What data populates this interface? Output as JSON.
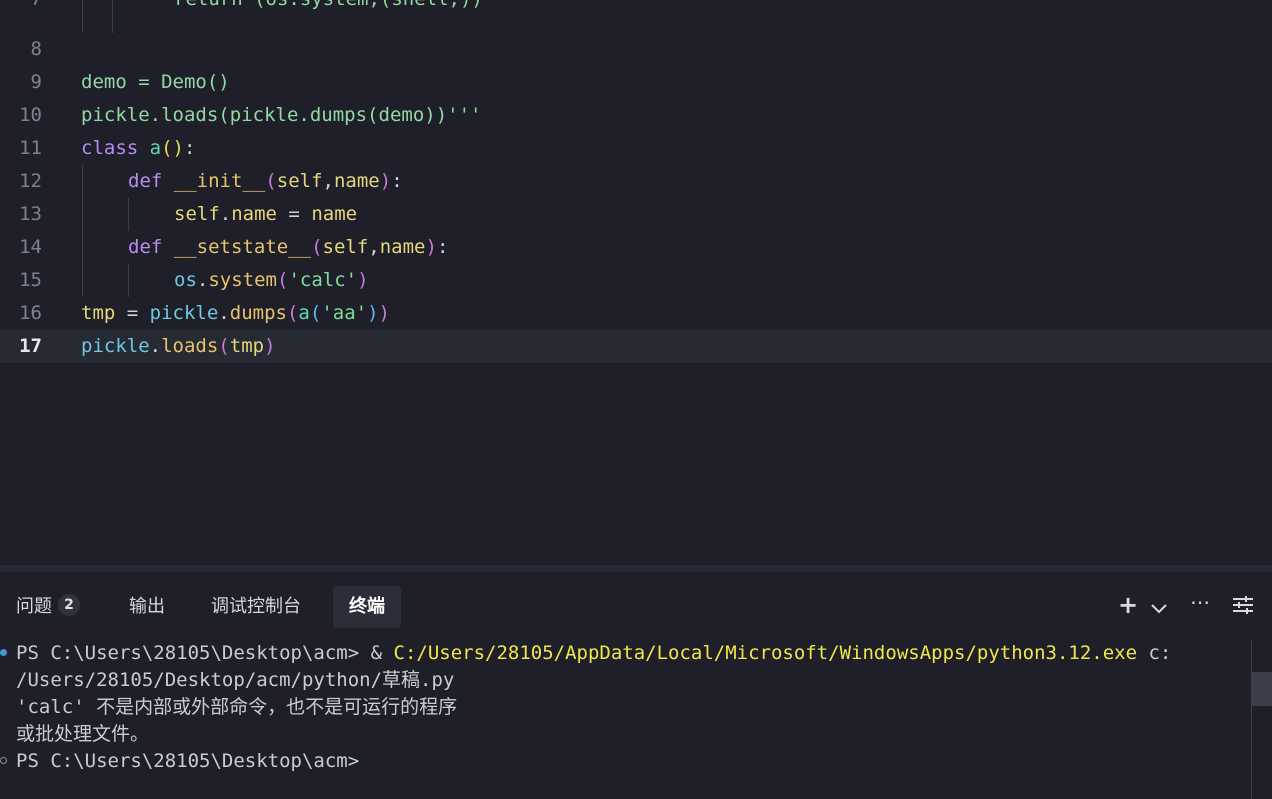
{
  "editor": {
    "lines": [
      {
        "num": "7",
        "partial": "return (os.system,(shell,))"
      },
      {
        "num": "8"
      },
      {
        "num": "9"
      },
      {
        "num": "10"
      },
      {
        "num": "11"
      },
      {
        "num": "12"
      },
      {
        "num": "13"
      },
      {
        "num": "14"
      },
      {
        "num": "15"
      },
      {
        "num": "16"
      },
      {
        "num": "17"
      }
    ],
    "tokens": {
      "demo": "demo",
      "eq": " = ",
      "Demo": "Demo",
      "call": "()",
      "pickle": "pickle",
      "dot": ".",
      "loads": "loads",
      "lp": "(",
      "dumps": "dumps",
      "demo_arg": "demo",
      "rpp": "))",
      "tq": "'''",
      "class": "class",
      "a": "a",
      "paren_call": "()",
      "colon": ":",
      "def": "def",
      "init": "__init__",
      "self": "self",
      "comma": ",",
      "name": "name",
      "rp": ")",
      "self2": "self",
      "name_attr": "name",
      "name_val": "name",
      "setstate": "__setstate__",
      "os": "os",
      "system": "system",
      "calc_str": "'calc'",
      "tmp": "tmp",
      "aa_str": "'aa'",
      "tmp_arg": "tmp"
    }
  },
  "panel": {
    "tabs": {
      "problems": "问题",
      "problems_count": "2",
      "output": "输出",
      "debug_console": "调试控制台",
      "terminal": "终端"
    },
    "icons": {
      "add": "plus-icon",
      "dropdown": "chevron-down-icon",
      "more": "more-icon",
      "layout": "sliders-icon"
    },
    "terminal": {
      "prompt1": "PS C:\\Users\\28105\\Desktop\\acm> & ",
      "exe_path": "C:/Users/28105/AppData/Local/Microsoft/WindowsApps/python3.12.exe",
      "arg_part1": " c:",
      "arg_part2": "/Users/28105/Desktop/acm/python/草稿.py",
      "error_line1": "'calc' 不是内部或外部命令，也不是可运行的程序",
      "error_line2": "或批处理文件。",
      "prompt2": "PS C:\\Users\\28105\\Desktop\\acm>"
    }
  },
  "colors": {
    "background": "#1e1f29",
    "current_line": "#262a33",
    "exe_path": "#f0e64a",
    "keyword": "#b98cf3",
    "string": "#7fdc99"
  }
}
